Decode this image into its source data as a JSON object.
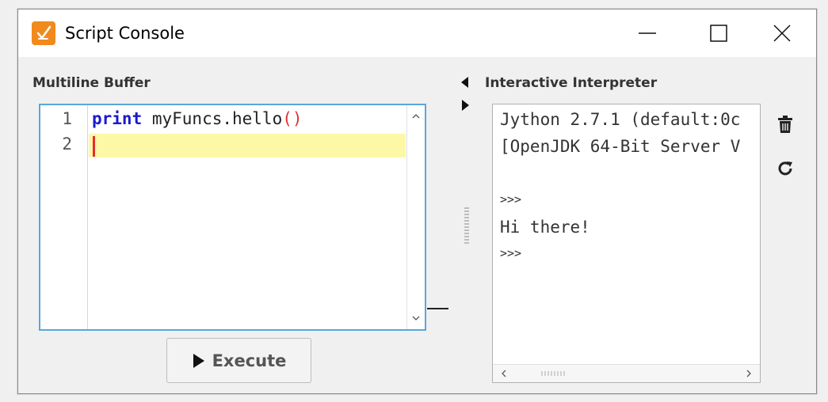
{
  "window": {
    "title": "Script Console",
    "app_icon": "ignition-script-icon",
    "accent_color": "#f18a1c",
    "controls": [
      "minimize-icon",
      "maximize-icon",
      "close-icon"
    ]
  },
  "buffer": {
    "label": "Multiline Buffer",
    "lines": [
      {
        "number": "1",
        "keyword": "print",
        "rest": " myFuncs.hello",
        "paren": "()"
      },
      {
        "number": "2",
        "keyword": "",
        "rest": "",
        "paren": ""
      }
    ],
    "current_line_color": "#fdf8a6",
    "border_color": "#5ba6dc"
  },
  "execute": {
    "label": "Execute",
    "icon": "play-icon"
  },
  "interpreter": {
    "label": "Interactive Interpreter",
    "output": [
      {
        "text": "Jython 2.7.1 (default:0c",
        "size": "big"
      },
      {
        "text": "[OpenJDK 64-Bit Server V",
        "size": "big"
      },
      {
        "text": ">>>",
        "size": "small"
      },
      {
        "text": "Hi there!",
        "size": "big"
      },
      {
        "text": ">>>",
        "size": "small"
      }
    ],
    "tools": [
      "trash-icon",
      "refresh-icon"
    ]
  }
}
